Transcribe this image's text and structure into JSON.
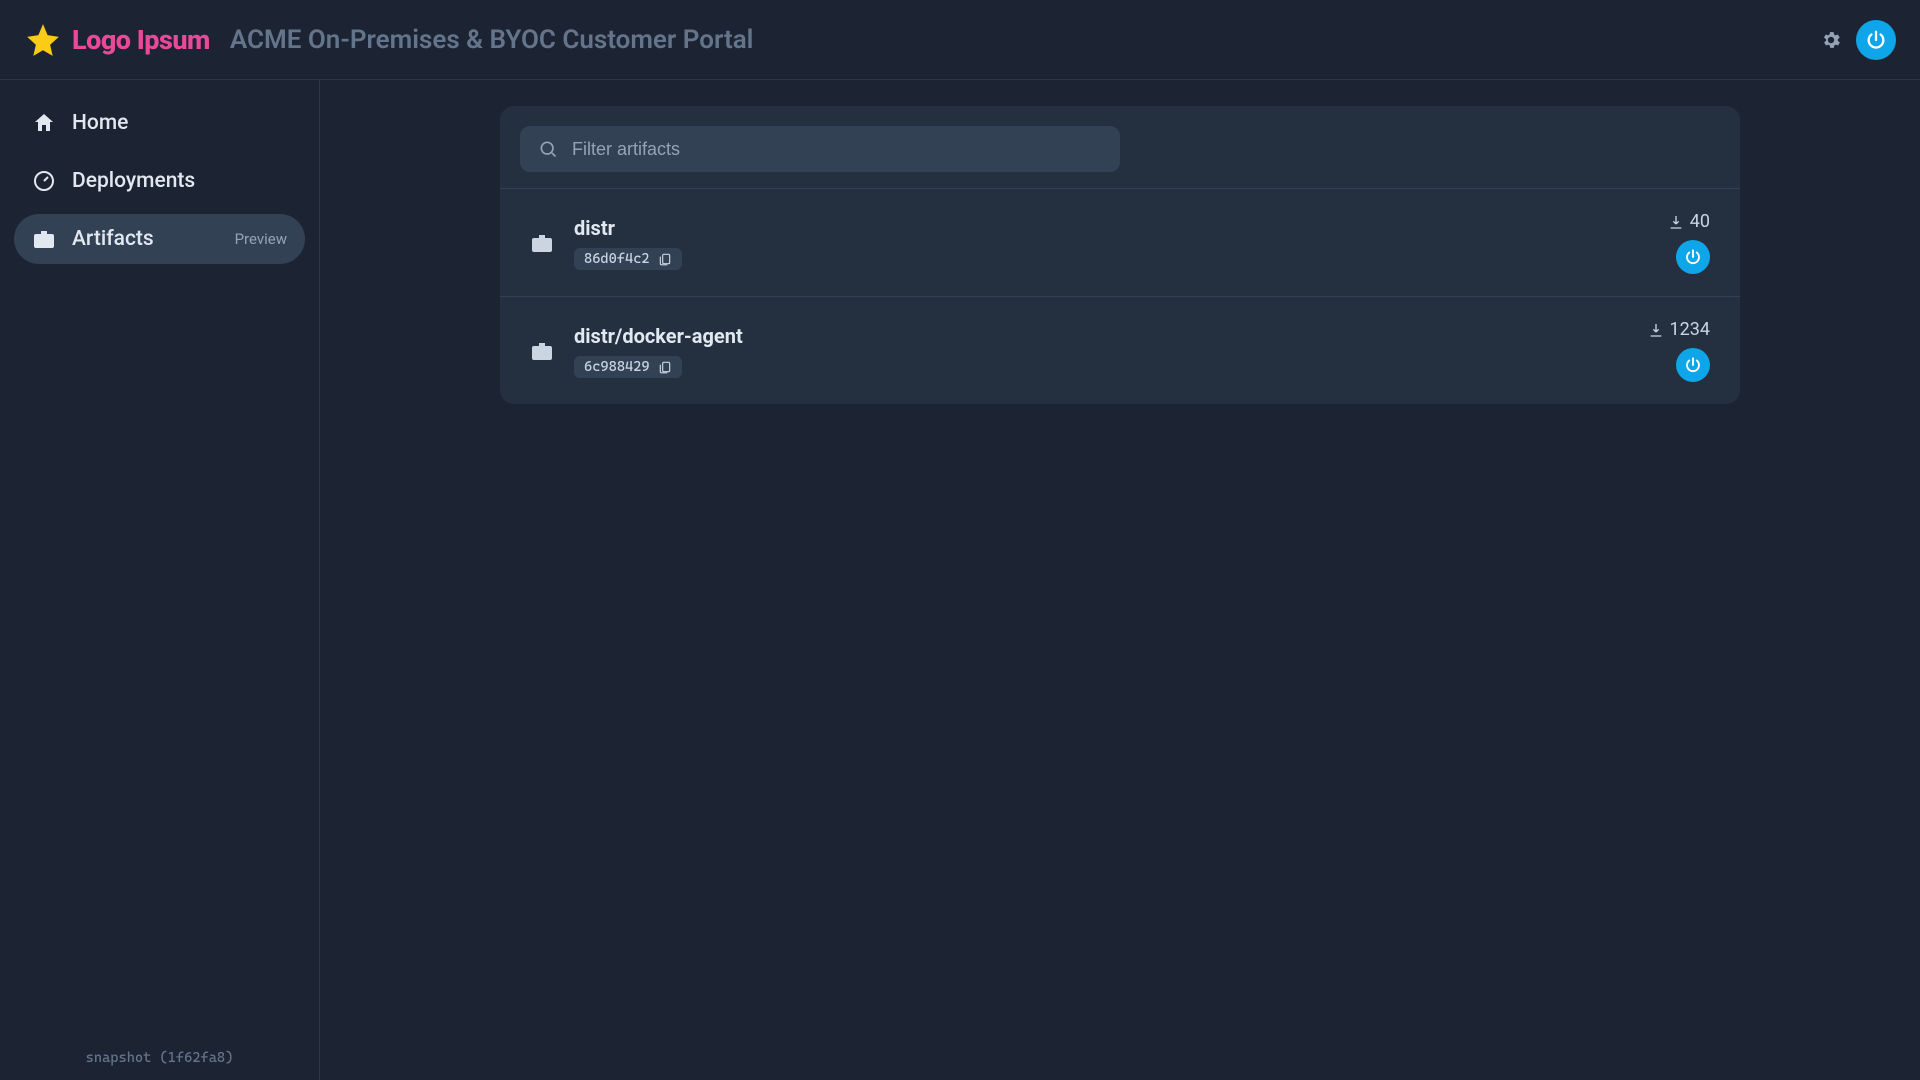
{
  "header": {
    "brand": "Logo Ipsum",
    "title": "ACME On-Premises & BYOC Customer Portal"
  },
  "sidebar": {
    "items": [
      {
        "label": "Home",
        "icon": "home",
        "active": false,
        "badge": null
      },
      {
        "label": "Deployments",
        "icon": "dashboard",
        "active": false,
        "badge": null
      },
      {
        "label": "Artifacts",
        "icon": "briefcase",
        "active": true,
        "badge": "Preview"
      }
    ],
    "snapshot": "snapshot (1f62fa8)"
  },
  "filter": {
    "placeholder": "Filter artifacts",
    "value": ""
  },
  "artifacts": [
    {
      "name": "distr",
      "hash": "86d0f4c2",
      "downloads": "40"
    },
    {
      "name": "distr/docker-agent",
      "hash": "6c988429",
      "downloads": "1234"
    }
  ]
}
